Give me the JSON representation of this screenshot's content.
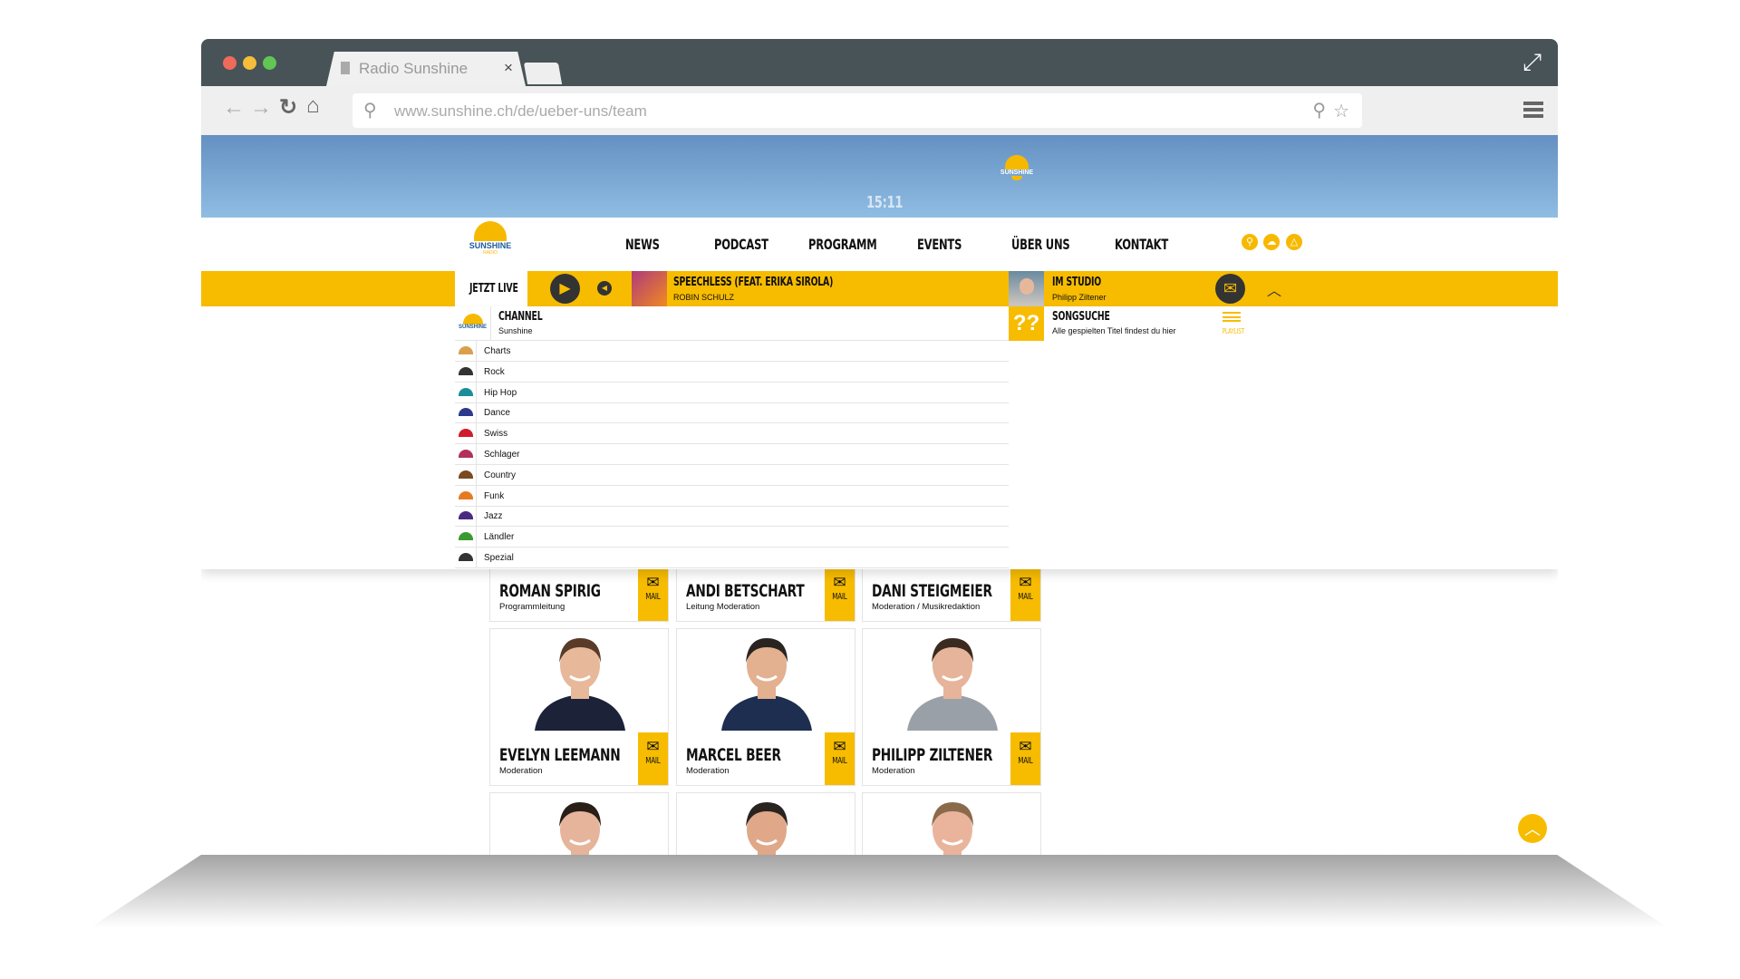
{
  "browser": {
    "tab_title": "Radio Sunshine",
    "tab_close": "×",
    "url": "www.sunshine.ch/de/ueber-uns/team"
  },
  "hero": {
    "logo_text": "SUNSHINE",
    "time": "15:11"
  },
  "nav": {
    "logo_text": "SUNSHINE",
    "logo_sub": "RADIO",
    "items": [
      "NEWS",
      "PODCAST",
      "PROGRAMM",
      "EVENTS",
      "ÜBER UNS",
      "KONTAKT"
    ],
    "icons": [
      "search-icon",
      "weather-icon",
      "traffic-warning-icon"
    ]
  },
  "live": {
    "label": "JETZT LIVE",
    "song_title": "SPEECHLESS (FEAT. ERIKA SIROLA)",
    "artist": "ROBIN SCHULZ",
    "studio_label": "IM STUDIO",
    "studio_host": "Philipp Ziltener"
  },
  "channels": {
    "header": "CHANNEL",
    "current": "Sunshine",
    "items": [
      "Charts",
      "Rock",
      "Hip Hop",
      "Dance",
      "Swiss",
      "Schlager",
      "Country",
      "Funk",
      "Jazz",
      "Ländler",
      "Spezial"
    ],
    "icon_colors": [
      "#d9a04a",
      "#333333",
      "#1a8f9a",
      "#2b3a8a",
      "#d01c2a",
      "#b0305a",
      "#7a4a20",
      "#e67a20",
      "#4a2a80",
      "#3a9a30",
      "#333333"
    ]
  },
  "songsuche": {
    "title": "SONGSUCHE",
    "subtitle": "Alle gespielten Titel findest du hier",
    "playlist": "PLAYLIST"
  },
  "team": [
    {
      "name": "ROMAN SPIRIG",
      "role": "Programmleitung",
      "mail": "MAIL"
    },
    {
      "name": "ANDI BETSCHART",
      "role": "Leitung Moderation",
      "mail": "MAIL"
    },
    {
      "name": "DANI STEIGMEIER",
      "role": "Moderation / Musikredaktion",
      "mail": "MAIL"
    },
    {
      "name": "EVELYN LEEMANN",
      "role": "Moderation",
      "mail": "MAIL"
    },
    {
      "name": "MARCEL BEER",
      "role": "Moderation",
      "mail": "MAIL"
    },
    {
      "name": "PHILIPP ZILTENER",
      "role": "Moderation",
      "mail": "MAIL"
    }
  ],
  "colors": {
    "accent": "#f7bc00",
    "titlebar": "#475357"
  }
}
